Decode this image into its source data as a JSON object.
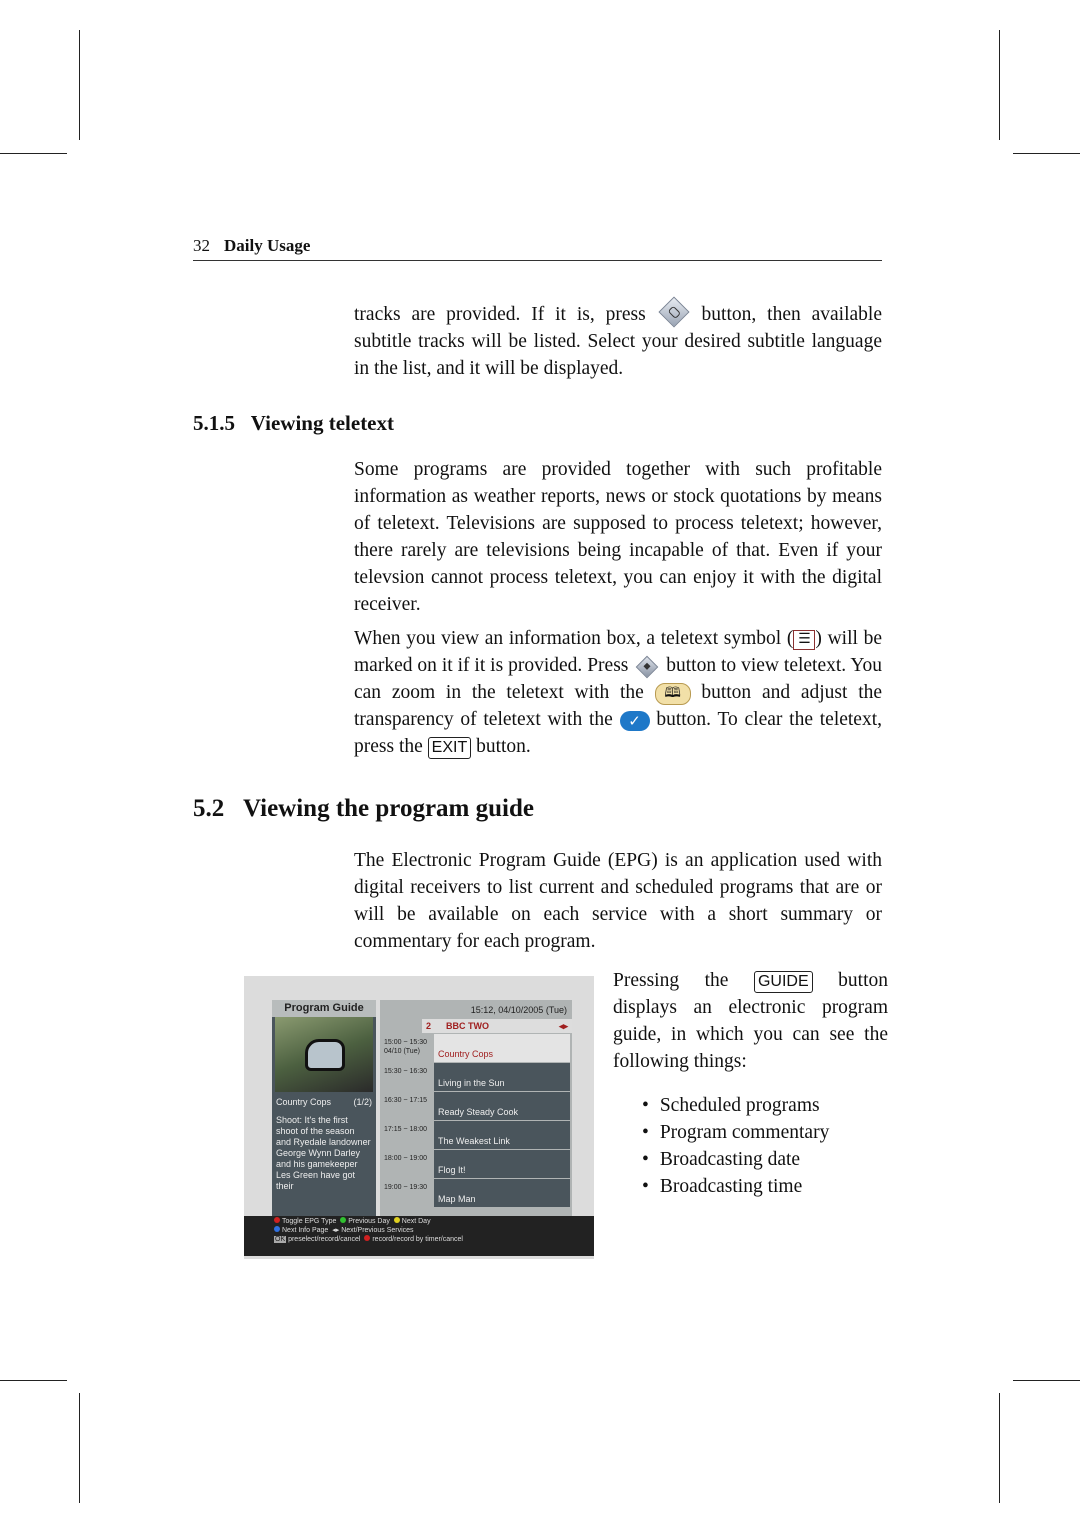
{
  "header": {
    "page_number": "32",
    "section": "Daily Usage"
  },
  "para_intro": {
    "a": "tracks are provided. If it is, press",
    "b": "button, then available subtitle tracks will be listed. Select your desired subtitle language in the list, and it will be displayed."
  },
  "sec515": {
    "number": "5.1.5",
    "title": "Viewing teletext"
  },
  "para_teletext1": "Some programs are provided together with such profitable information as weather reports, news or stock quotations by means of teletext. Televisions are supposed to process teletext; however, there rarely are televisions being incapable of that. Even if your televsion cannot process teletext, you can enjoy it with the digital receiver.",
  "para_teletext2": {
    "a": "When you view an information box, a teletext symbol (",
    "b": ") will be marked on it if it is provided. Press",
    "c": "button to view teletext. You can zoom in the teletext with the",
    "d": "button and adjust the transparency of teletext with the",
    "e": "button. To clear the teletext, press the",
    "exit_key": "EXIT",
    "f": "button."
  },
  "sec52": {
    "number": "5.2",
    "title": "Viewing the program guide"
  },
  "para_epg": "The Electronic Program Guide (EPG) is an application used with digital receivers to list current and scheduled programs that are or will be available on each service with a short summary or commentary for each program.",
  "para_guide": {
    "a": "Pressing the",
    "key": "GUIDE",
    "b": "button displays an electronic program guide, in which you can see the following things:"
  },
  "bullets": [
    "Scheduled programs",
    "Program commentary",
    "Broadcasting date",
    "Broadcasting time"
  ],
  "icons": {
    "subtitle_button": "diamond-subtitle-icon",
    "teletext_symbol": "teletext-symbol-icon",
    "teletext_button": "diamond-teletext-icon",
    "zoom_button": "book-icon",
    "transparency_button": "checkmark-icon"
  },
  "epg": {
    "title": "Program Guide",
    "clock": "15:12, 04/10/2005 (Tue)",
    "channel_number": "2",
    "channel_name": "BBC TWO",
    "channel_arrows": "◂▸",
    "info_title": "Country Cops",
    "info_page": "(1/2)",
    "info_desc": "Shoot: It's the first shoot of the season and Ryedale landowner George Wynn Darley and his gamekeeper Les Green have got their",
    "rows": [
      {
        "time": "15:00 ~ 15:30",
        "date": "04/10 (Tue)",
        "program": "Country Cops",
        "selected": true
      },
      {
        "time": "15:30 ~ 16:30",
        "date": "",
        "program": "Living in the Sun"
      },
      {
        "time": "16:30 ~ 17:15",
        "date": "",
        "program": "Ready Steady Cook"
      },
      {
        "time": "17:15 ~ 18:00",
        "date": "",
        "program": "The Weakest Link"
      },
      {
        "time": "18:00 ~ 19:00",
        "date": "",
        "program": "Flog It!"
      },
      {
        "time": "19:00 ~ 19:30",
        "date": "",
        "program": "Map Man"
      }
    ],
    "footer": {
      "red": "Toggle EPG Type",
      "green": "Previous Day",
      "yellow": "Next Day",
      "blue": "Next Info Page",
      "arrows": "Next/Previous Services",
      "ok_key": "OK",
      "ok": "preselect/record/cancel",
      "rec": "record/record by timer/cancel"
    },
    "colors": {
      "red": "#d02020",
      "green": "#30c030",
      "yellow": "#e0d020",
      "blue": "#3070e0"
    }
  }
}
